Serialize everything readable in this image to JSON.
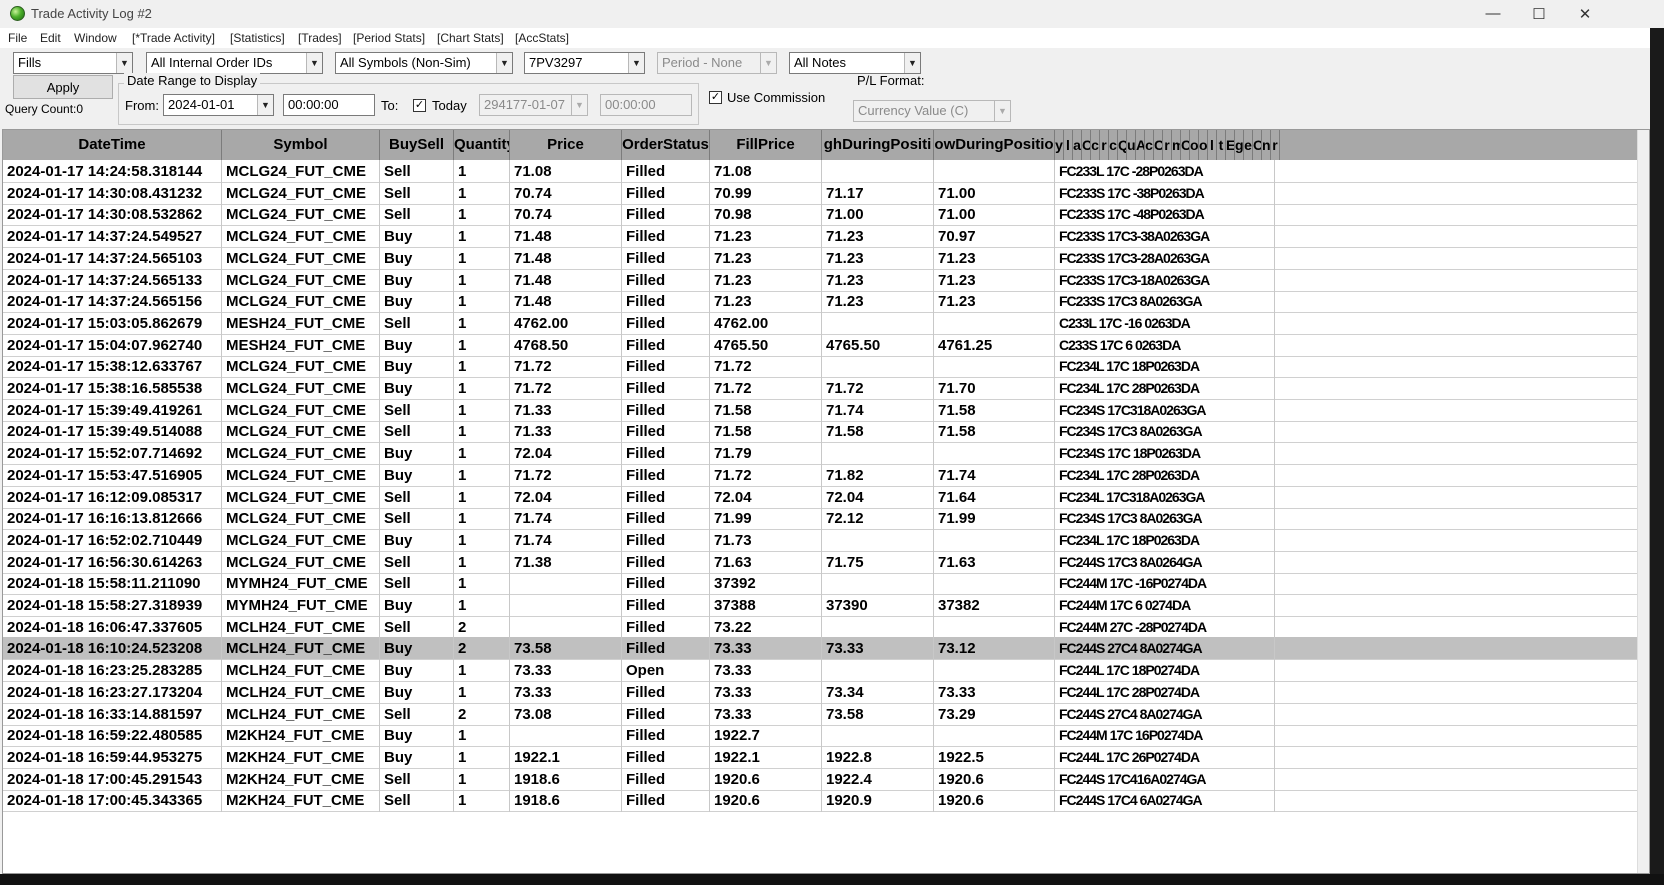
{
  "window": {
    "title": "Trade Activity Log #2",
    "minimize": "—",
    "maximize": "☐",
    "close": "✕"
  },
  "menu": [
    "File",
    "Edit",
    "Window",
    "[*Trade Activity]",
    "[Statistics]",
    "[Trades]",
    "[Period Stats]",
    "[Chart Stats]",
    "[AccStats]"
  ],
  "toolbar": {
    "type_select": "Fills",
    "order_ids_select": "All Internal Order IDs",
    "symbols_select": "All Symbols (Non-Sim)",
    "account_select": "7PV3297",
    "period_select": "Period - None",
    "notes_select": "All Notes",
    "apply_label": "Apply",
    "query_count": "Query Count:0",
    "date_range_label": "Date Range to Display",
    "from_label": "From:",
    "from_date": "2024-01-01",
    "from_time": "00:00:00",
    "to_label": "To:",
    "today_label": "Today",
    "to_date": "294177-01-07",
    "to_time": "00:00:00",
    "use_commission_label": "Use Commission",
    "pl_format_label": "P/L Format:",
    "pl_format_select": "Currency Value (C)"
  },
  "table": {
    "columns": [
      "DateTime",
      "Symbol",
      "BuySell",
      "Quantity",
      "Price",
      "OrderStatus",
      "FillPrice",
      "ghDuringPositi",
      "owDuringPositio",
      "y",
      "l",
      "a",
      "C",
      "c",
      "r",
      "c",
      "Q",
      "u",
      "A",
      "c",
      "C",
      "r",
      "m",
      "C",
      "o",
      "o",
      "l",
      "t",
      "E",
      "g",
      "e",
      "O",
      "n",
      "r",
      "n"
    ],
    "rows": [
      {
        "dt": "2024-01-17  14:24:58.318144",
        "sym": "MCLG24_FUT_CME",
        "side": "Sell",
        "qty": "1",
        "price": "71.08",
        "status": "Filled",
        "fill": "71.08",
        "high": "",
        "low": "",
        "tail": "FC233L 17C  -28P0263DA"
      },
      {
        "dt": "2024-01-17  14:30:08.431232",
        "sym": "MCLG24_FUT_CME",
        "side": "Sell",
        "qty": "1",
        "price": "70.74",
        "status": "Filled",
        "fill": "70.99",
        "high": "71.17",
        "low": "71.00",
        "tail": "FC233S 17C  -38P0263DA"
      },
      {
        "dt": "2024-01-17  14:30:08.532862",
        "sym": "MCLG24_FUT_CME",
        "side": "Sell",
        "qty": "1",
        "price": "70.74",
        "status": "Filled",
        "fill": "70.98",
        "high": "71.00",
        "low": "71.00",
        "tail": "FC233S 17C  -48P0263DA"
      },
      {
        "dt": "2024-01-17  14:37:24.549527",
        "sym": "MCLG24_FUT_CME",
        "side": "Buy",
        "qty": "1",
        "price": "71.48",
        "status": "Filled",
        "fill": "71.23",
        "high": "71.23",
        "low": "70.97",
        "tail": "FC233S 17C3-38A0263GA"
      },
      {
        "dt": "2024-01-17  14:37:24.565103",
        "sym": "MCLG24_FUT_CME",
        "side": "Buy",
        "qty": "1",
        "price": "71.48",
        "status": "Filled",
        "fill": "71.23",
        "high": "71.23",
        "low": "71.23",
        "tail": "FC233S 17C3-28A0263GA"
      },
      {
        "dt": "2024-01-17  14:37:24.565133",
        "sym": "MCLG24_FUT_CME",
        "side": "Buy",
        "qty": "1",
        "price": "71.48",
        "status": "Filled",
        "fill": "71.23",
        "high": "71.23",
        "low": "71.23",
        "tail": "FC233S 17C3-18A0263GA"
      },
      {
        "dt": "2024-01-17  14:37:24.565156",
        "sym": "MCLG24_FUT_CME",
        "side": "Buy",
        "qty": "1",
        "price": "71.48",
        "status": "Filled",
        "fill": "71.23",
        "high": "71.23",
        "low": "71.23",
        "tail": "FC233S 17C3  8A0263GA"
      },
      {
        "dt": "2024-01-17  15:03:05.862679",
        "sym": "MESH24_FUT_CME",
        "side": "Sell",
        "qty": "1",
        "price": "4762.00",
        "status": "Filled",
        "fill": "4762.00",
        "high": "",
        "low": "",
        "tail": " C233L 17C  -16  0263DA"
      },
      {
        "dt": "2024-01-17  15:04:07.962740",
        "sym": "MESH24_FUT_CME",
        "side": "Buy",
        "qty": "1",
        "price": "4768.50",
        "status": "Filled",
        "fill": "4765.50",
        "high": "4765.50",
        "low": "4761.25",
        "tail": " C233S 17C   6  0263DA"
      },
      {
        "dt": "2024-01-17  15:38:12.633767",
        "sym": "MCLG24_FUT_CME",
        "side": "Buy",
        "qty": "1",
        "price": "71.72",
        "status": "Filled",
        "fill": "71.72",
        "high": "",
        "low": "",
        "tail": "FC234L 17C  18P0263DA"
      },
      {
        "dt": "2024-01-17  15:38:16.585538",
        "sym": "MCLG24_FUT_CME",
        "side": "Buy",
        "qty": "1",
        "price": "71.72",
        "status": "Filled",
        "fill": "71.72",
        "high": "71.72",
        "low": "71.70",
        "tail": "FC234L 17C  28P0263DA"
      },
      {
        "dt": "2024-01-17  15:39:49.419261",
        "sym": "MCLG24_FUT_CME",
        "side": "Sell",
        "qty": "1",
        "price": "71.33",
        "status": "Filled",
        "fill": "71.58",
        "high": "71.74",
        "low": "71.58",
        "tail": "FC234S 17C318A0263GA"
      },
      {
        "dt": "2024-01-17  15:39:49.514088",
        "sym": "MCLG24_FUT_CME",
        "side": "Sell",
        "qty": "1",
        "price": "71.33",
        "status": "Filled",
        "fill": "71.58",
        "high": "71.58",
        "low": "71.58",
        "tail": "FC234S 17C3  8A0263GA"
      },
      {
        "dt": "2024-01-17  15:52:07.714692",
        "sym": "MCLG24_FUT_CME",
        "side": "Buy",
        "qty": "1",
        "price": "72.04",
        "status": "Filled",
        "fill": "71.79",
        "high": "",
        "low": "",
        "tail": "FC234S 17C  18P0263DA"
      },
      {
        "dt": "2024-01-17  15:53:47.516905",
        "sym": "MCLG24_FUT_CME",
        "side": "Buy",
        "qty": "1",
        "price": "71.72",
        "status": "Filled",
        "fill": "71.72",
        "high": "71.82",
        "low": "71.74",
        "tail": "FC234L 17C  28P0263DA"
      },
      {
        "dt": "2024-01-17  16:12:09.085317",
        "sym": "MCLG24_FUT_CME",
        "side": "Sell",
        "qty": "1",
        "price": "72.04",
        "status": "Filled",
        "fill": "72.04",
        "high": "72.04",
        "low": "71.64",
        "tail": "FC234L 17C318A0263GA"
      },
      {
        "dt": "2024-01-17  16:16:13.812666",
        "sym": "MCLG24_FUT_CME",
        "side": "Sell",
        "qty": "1",
        "price": "71.74",
        "status": "Filled",
        "fill": "71.99",
        "high": "72.12",
        "low": "71.99",
        "tail": "FC234S 17C3  8A0263GA"
      },
      {
        "dt": "2024-01-17  16:52:02.710449",
        "sym": "MCLG24_FUT_CME",
        "side": "Buy",
        "qty": "1",
        "price": "71.74",
        "status": "Filled",
        "fill": "71.73",
        "high": "",
        "low": "",
        "tail": "FC234L 17C  18P0263DA"
      },
      {
        "dt": "2024-01-17  16:56:30.614263",
        "sym": "MCLG24_FUT_CME",
        "side": "Sell",
        "qty": "1",
        "price": "71.38",
        "status": "Filled",
        "fill": "71.63",
        "high": "71.75",
        "low": "71.63",
        "tail": "FC244S 17C3  8A0264GA"
      },
      {
        "dt": "2024-01-18  15:58:11.211090",
        "sym": "MYMH24_FUT_CME",
        "side": "Sell",
        "qty": "1",
        "price": "",
        "status": "Filled",
        "fill": "37392",
        "high": "",
        "low": "",
        "tail": "FC244M 17C  -16P0274DA"
      },
      {
        "dt": "2024-01-18  15:58:27.318939",
        "sym": "MYMH24_FUT_CME",
        "side": "Buy",
        "qty": "1",
        "price": "",
        "status": "Filled",
        "fill": "37388",
        "high": "37390",
        "low": "37382",
        "tail": "FC244M 17C   6  0274DA"
      },
      {
        "dt": "2024-01-18  16:06:47.337605",
        "sym": "MCLH24_FUT_CME",
        "side": "Sell",
        "qty": "2",
        "price": "",
        "status": "Filled",
        "fill": "73.22",
        "high": "",
        "low": "",
        "tail": "FC244M 27C  -28P0274DA"
      },
      {
        "dt": "2024-01-18  16:10:24.523208",
        "sym": "MCLH24_FUT_CME",
        "side": "Buy",
        "qty": "2",
        "price": "73.58",
        "status": "Filled",
        "fill": "73.33",
        "high": "73.33",
        "low": "73.12",
        "tail": "FC244S 27C4  8A0274GA",
        "selected": true
      },
      {
        "dt": "2024-01-18  16:23:25.283285",
        "sym": "MCLH24_FUT_CME",
        "side": "Buy",
        "qty": "1",
        "price": "73.33",
        "status": "Open",
        "fill": "73.33",
        "high": "",
        "low": "",
        "tail": "FC244L 17C  18P0274DA"
      },
      {
        "dt": "2024-01-18  16:23:27.173204",
        "sym": "MCLH24_FUT_CME",
        "side": "Buy",
        "qty": "1",
        "price": "73.33",
        "status": "Filled",
        "fill": "73.33",
        "high": "73.34",
        "low": "73.33",
        "tail": "FC244L 17C  28P0274DA"
      },
      {
        "dt": "2024-01-18  16:33:14.881597",
        "sym": "MCLH24_FUT_CME",
        "side": "Sell",
        "qty": "2",
        "price": "73.08",
        "status": "Filled",
        "fill": "73.33",
        "high": "73.58",
        "low": "73.29",
        "tail": "FC244S 27C4  8A0274GA"
      },
      {
        "dt": "2024-01-18  16:59:22.480585",
        "sym": "M2KH24_FUT_CME",
        "side": "Buy",
        "qty": "1",
        "price": "",
        "status": "Filled",
        "fill": "1922.7",
        "high": "",
        "low": "",
        "tail": "FC244M 17C  16P0274DA"
      },
      {
        "dt": "2024-01-18  16:59:44.953275",
        "sym": "M2KH24_FUT_CME",
        "side": "Buy",
        "qty": "1",
        "price": "1922.1",
        "status": "Filled",
        "fill": "1922.1",
        "high": "1922.8",
        "low": "1922.5",
        "tail": "FC244L 17C  26P0274DA"
      },
      {
        "dt": "2024-01-18  17:00:45.291543",
        "sym": "M2KH24_FUT_CME",
        "side": "Sell",
        "qty": "1",
        "price": "1918.6",
        "status": "Filled",
        "fill": "1920.6",
        "high": "1922.4",
        "low": "1920.6",
        "tail": "FC244S 17C416A0274GA"
      },
      {
        "dt": "2024-01-18  17:00:45.343365",
        "sym": "M2KH24_FUT_CME",
        "side": "Sell",
        "qty": "1",
        "price": "1918.6",
        "status": "Filled",
        "fill": "1920.6",
        "high": "1920.9",
        "low": "1920.6",
        "tail": "FC244S 17C4  6A0274GA"
      }
    ]
  }
}
